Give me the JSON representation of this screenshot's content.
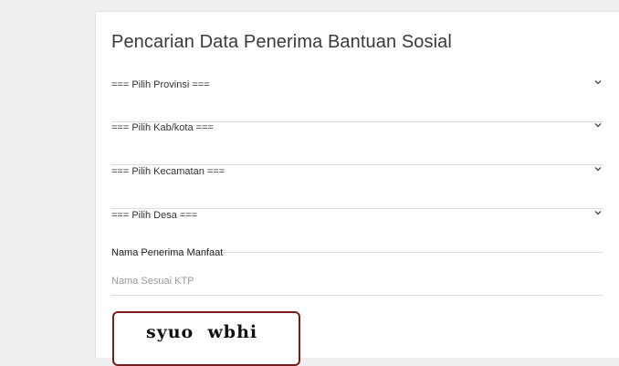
{
  "form": {
    "title": "Pencarian Data Penerima Bantuan Sosial",
    "selects": [
      {
        "label": "=== Pilih Provinsi ==="
      },
      {
        "label": "=== Pilih Kab/kota ==="
      },
      {
        "label": "=== Pilih Kecamatan ==="
      },
      {
        "label": "=== Pilih Desa ==="
      }
    ],
    "name_field": {
      "label": "Nama Penerima Manfaat",
      "placeholder": "Nama Sesuai KTP",
      "value": ""
    },
    "captcha": {
      "text": "syuo  wbhi"
    }
  },
  "colors": {
    "background": "#efefef",
    "card": "#ffffff",
    "divider": "#dcdcdc",
    "captcha_border": "#7a1c1c"
  },
  "icons": {
    "select_arrow": "chevron-down-icon"
  }
}
